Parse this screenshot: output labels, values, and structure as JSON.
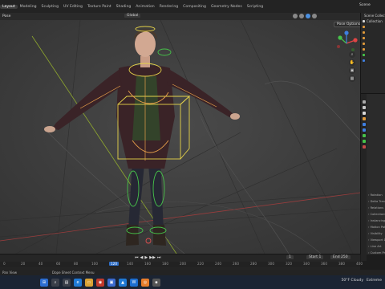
{
  "workspaces": [
    "Layout",
    "Modeling",
    "Sculpting",
    "UV Editing",
    "Texture Paint",
    "Shading",
    "Animation",
    "Rendering",
    "Compositing",
    "Geometry Nodes",
    "Scripting"
  ],
  "active_workspace": "Layout",
  "scene_label": "Scene",
  "viewport": {
    "mode_label": "Pose",
    "transform_orientation": "Global",
    "pose_options_label": "Pose Options",
    "accent_color": "#e6d34a",
    "bone_color": "#e8a04a"
  },
  "outliner": {
    "items": [
      "Scene Collection",
      "Collection",
      "",
      "",
      "",
      "",
      "",
      "",
      ""
    ]
  },
  "properties": {
    "header": "",
    "rows": [
      "Rotation",
      "Delta Transform",
      "Relations",
      "Collections",
      "Instancing",
      "Motion Paths",
      "Visibility",
      "Viewport Display",
      "Line Art",
      "Custom Properties"
    ]
  },
  "timeline": {
    "ruler_labels": [
      "0",
      "20",
      "40",
      "60",
      "80",
      "100",
      "120",
      "140",
      "160",
      "180",
      "200",
      "220",
      "240",
      "260",
      "280",
      "300",
      "320",
      "340",
      "360",
      "380",
      "400"
    ],
    "current_frame": "120",
    "start_label": "Start",
    "start_value": "1",
    "end_label": "End",
    "end_value": "250",
    "frame_field": "1"
  },
  "status_bar": {
    "left_text": "Pan View",
    "middle_text": "Dope Sheet Context Menu"
  },
  "taskbar": {
    "weather": "50°F Cloudy",
    "extra": "Extreme"
  }
}
